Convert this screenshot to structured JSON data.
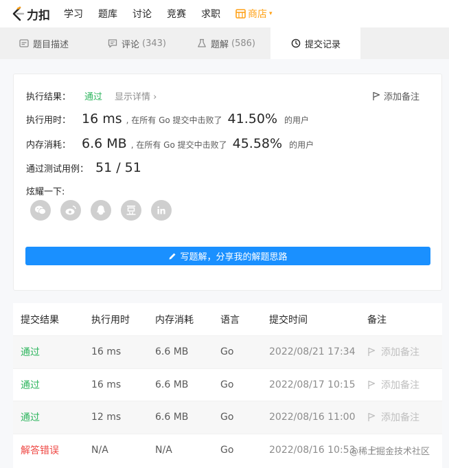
{
  "nav": {
    "logo_text": "力扣",
    "items": [
      "学习",
      "题库",
      "讨论",
      "竞赛",
      "求职"
    ],
    "store": "商店",
    "colors": {
      "store": "#ffa116"
    }
  },
  "tabs": [
    {
      "label": "题目描述",
      "icon": "description-icon"
    },
    {
      "label": "评论",
      "count": "(343)",
      "icon": "comment-icon"
    },
    {
      "label": "题解",
      "count": "(586)",
      "icon": "flask-icon"
    },
    {
      "label": "提交记录",
      "icon": "clock-icon",
      "active": true
    }
  ],
  "result": {
    "exec_label": "执行结果：",
    "exec_value": "通过",
    "show_detail": "显示详情 ›",
    "add_note": "添加备注",
    "time_label": "执行用时：",
    "time_value": "16 ms",
    "time_beat": ", 在所有 Go 提交中击败了",
    "time_pct": "41.50%",
    "time_users": "的用户",
    "mem_label": "内存消耗：",
    "mem_value": "6.6 MB",
    "mem_beat": ", 在所有 Go 提交中击败了",
    "mem_pct": "45.58%",
    "mem_users": "的用户",
    "tests_label": "通过测试用例：",
    "tests_value": "51 / 51",
    "share_label": "炫耀一下:",
    "share_icons": [
      "wechat-icon",
      "weibo-icon",
      "qq-icon",
      "douban-icon",
      "linkedin-icon"
    ],
    "write_button": "写题解，分享我的解题思路",
    "colors": {
      "pass": "#2db55d",
      "button": "#1a90ff"
    }
  },
  "table": {
    "headers": [
      "提交结果",
      "执行用时",
      "内存消耗",
      "语言",
      "提交时间",
      "备注"
    ],
    "rows": [
      {
        "status": "通过",
        "time": "16 ms",
        "memory": "6.6 MB",
        "lang": "Go",
        "submitted": "2022/08/21 17:34",
        "note": "添加备注"
      },
      {
        "status": "通过",
        "time": "16 ms",
        "memory": "6.6 MB",
        "lang": "Go",
        "submitted": "2022/08/17 10:15",
        "note": "添加备注"
      },
      {
        "status": "通过",
        "time": "12 ms",
        "memory": "6.6 MB",
        "lang": "Go",
        "submitted": "2022/08/16 11:00",
        "note": "添加备注"
      },
      {
        "status": "解答错误",
        "time": "N/A",
        "memory": "N/A",
        "lang": "Go",
        "submitted": "2022/08/16 10:53",
        "note": ""
      }
    ],
    "watermark": "@稀土掘金技术社区",
    "colors": {
      "fail": "#ef4743"
    }
  }
}
